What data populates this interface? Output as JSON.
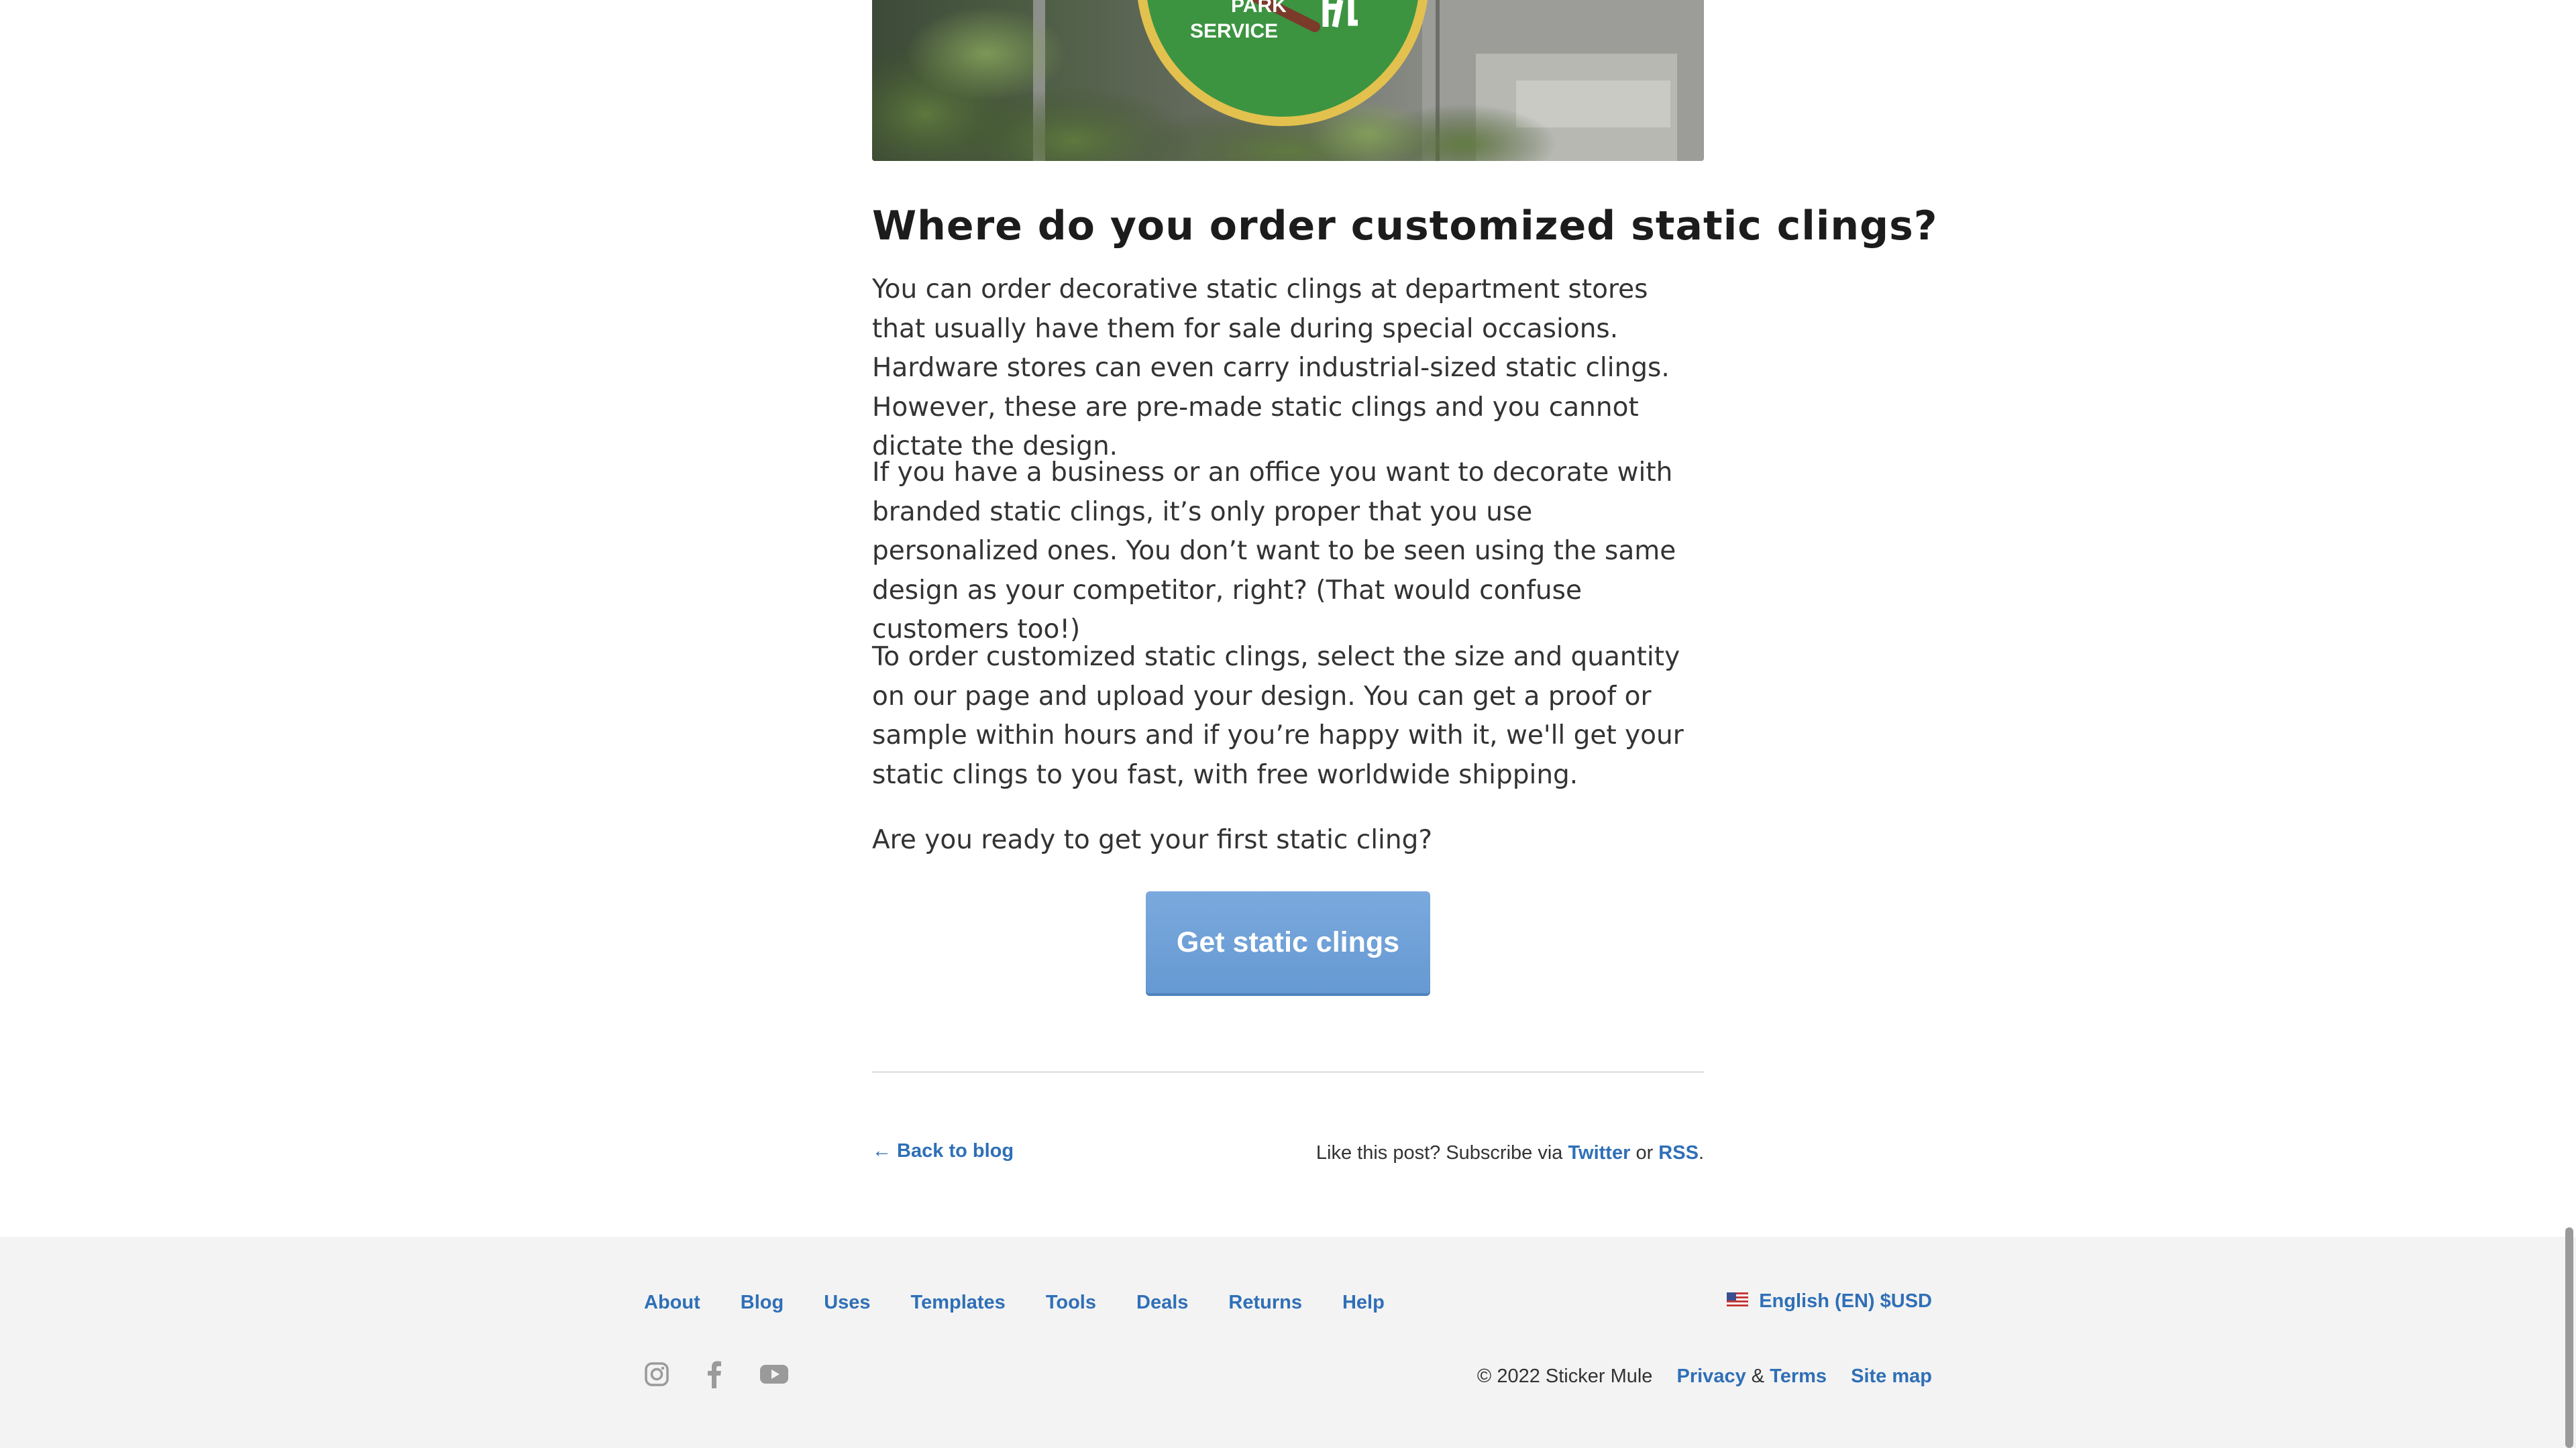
{
  "hero": {
    "sign_text_line1": "PARK",
    "sign_text_line2": "SERVICE"
  },
  "article": {
    "heading": "Where do you order customized static clings?",
    "paragraphs": [
      "You can order decorative static clings at department stores that usually have them for sale during special occasions. Hardware stores can even carry industrial-sized static clings. However, these are pre-made static clings and you cannot dictate the design.",
      "If you have a business or an office you want to decorate with branded static clings, it’s only proper that you use personalized ones. You don’t want to be seen using the same design as your competitor, right? (That would confuse customers too!)",
      "To order customized static clings, select the size and quantity on our page and upload your design. You can get a proof or sample within hours and if you’re happy with it, we'll get your static clings to you fast, with free worldwide shipping.",
      "Are you ready to get your first static cling?"
    ],
    "cta_label": "Get static clings"
  },
  "post_footer": {
    "back_link": "← Back to blog",
    "subscribe_prefix": "Like this post? Subscribe via",
    "twitter_label": "Twitter",
    "or_text": "or",
    "rss_label": "RSS",
    "period": "."
  },
  "footer": {
    "nav": [
      "About",
      "Blog",
      "Uses",
      "Templates",
      "Tools",
      "Deals",
      "Returns",
      "Help"
    ],
    "language": "English (EN) $USD",
    "copyright": "© 2022 Sticker Mule",
    "privacy_label": "Privacy",
    "amp": "&",
    "terms_label": "Terms",
    "sitemap_label": "Site map",
    "social_icons": [
      "instagram-icon",
      "facebook-icon",
      "youtube-icon"
    ]
  },
  "colors": {
    "link": "#2f6fb7",
    "cta": "#6699d2",
    "text": "#333333",
    "heading": "#1c1c1c",
    "footer_bg": "#f3f3f3"
  }
}
